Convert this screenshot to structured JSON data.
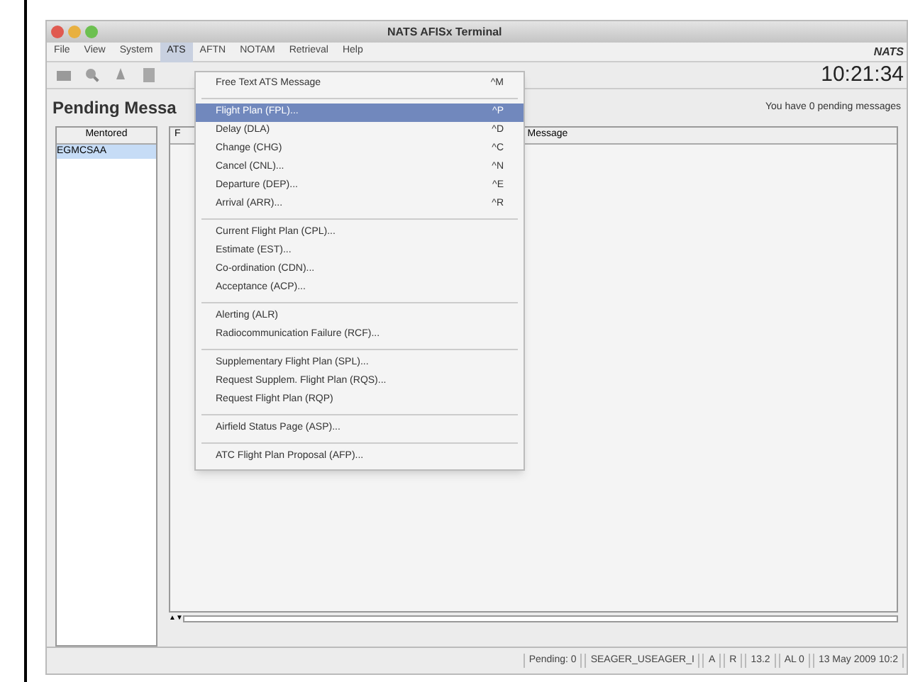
{
  "window": {
    "title": "NATS AFISx Terminal"
  },
  "menu_bar": [
    {
      "label": "File",
      "selected": false
    },
    {
      "label": "View",
      "selected": false
    },
    {
      "label": "System",
      "selected": false
    },
    {
      "label": "ATS",
      "selected": true
    },
    {
      "label": "AFTN",
      "selected": false
    },
    {
      "label": "NOTAM",
      "selected": false
    },
    {
      "label": "Retrieval",
      "selected": false
    },
    {
      "label": "Help",
      "selected": false
    }
  ],
  "logo": "NATS",
  "clock": "10:21:34",
  "heading": "Pending Messa",
  "pending_note": "You have 0 pending messages",
  "mentored": {
    "header": "Mentored",
    "items": [
      {
        "label": "EGMCSAA",
        "selected": true
      }
    ]
  },
  "table": {
    "columns": [
      "F",
      "Message"
    ]
  },
  "ats_menu": [
    {
      "kind": "item",
      "label": "Free Text ATS Message",
      "shortcut": "^M",
      "selected": false
    },
    {
      "kind": "separator"
    },
    {
      "kind": "item",
      "label": "Flight Plan (FPL)...",
      "shortcut": "^P",
      "selected": true
    },
    {
      "kind": "item",
      "label": "Delay (DLA)",
      "shortcut": "^D",
      "selected": false
    },
    {
      "kind": "item",
      "label": "Change (CHG)",
      "shortcut": "^C",
      "selected": false
    },
    {
      "kind": "item",
      "label": "Cancel (CNL)...",
      "shortcut": "^N",
      "selected": false
    },
    {
      "kind": "item",
      "label": "Departure (DEP)...",
      "shortcut": "^E",
      "selected": false
    },
    {
      "kind": "item",
      "label": "Arrival (ARR)...",
      "shortcut": "^R",
      "selected": false
    },
    {
      "kind": "separator"
    },
    {
      "kind": "item",
      "label": "Current Flight Plan (CPL)...",
      "selected": false
    },
    {
      "kind": "item",
      "label": "Estimate (EST)...",
      "selected": false
    },
    {
      "kind": "item",
      "label": "Co-ordination (CDN)...",
      "selected": false
    },
    {
      "kind": "item",
      "label": "Acceptance (ACP)...",
      "selected": false
    },
    {
      "kind": "separator"
    },
    {
      "kind": "item",
      "label": "Alerting (ALR)",
      "selected": false
    },
    {
      "kind": "item",
      "label": "Radiocommunication Failure (RCF)...",
      "selected": false
    },
    {
      "kind": "separator"
    },
    {
      "kind": "item",
      "label": "Supplementary Flight Plan (SPL)...",
      "selected": false
    },
    {
      "kind": "item",
      "label": "Request Supplem. Flight Plan (RQS)...",
      "selected": false
    },
    {
      "kind": "item",
      "label": "Request Flight Plan (RQP)",
      "selected": false
    },
    {
      "kind": "separator"
    },
    {
      "kind": "item",
      "label": "Airfield Status Page (ASP)...",
      "selected": false
    },
    {
      "kind": "separator"
    },
    {
      "kind": "item",
      "label": "ATC Flight Plan Proposal (AFP)...",
      "selected": false
    }
  ],
  "scroll_arrows": "▲▼",
  "status_bar": [
    "Pending: 0",
    "SEAGER_USEAGER_I",
    "A",
    "R",
    "13.2",
    "AL 0",
    "13 May 2009 10:2"
  ]
}
